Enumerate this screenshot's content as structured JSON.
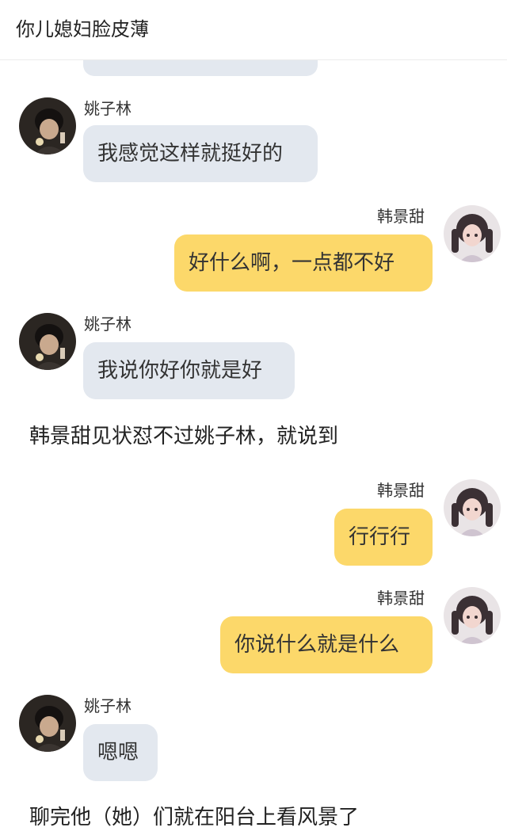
{
  "header": {
    "title": "你儿媳妇脸皮薄"
  },
  "participants": {
    "left_name": "姚子林",
    "right_name": "韩景甜"
  },
  "messages": [
    {
      "side": "left",
      "sender": "姚子林",
      "text": "我感觉这样就挺好的"
    },
    {
      "side": "right",
      "sender": "韩景甜",
      "text": "好什么啊，一点都不好"
    },
    {
      "side": "left",
      "sender": "姚子林",
      "text": "我说你好你就是好"
    },
    {
      "type": "narration",
      "text": "韩景甜见状怼不过姚子林，就说到"
    },
    {
      "side": "right",
      "sender": "韩景甜",
      "text": "行行行"
    },
    {
      "side": "right",
      "sender": "韩景甜",
      "text": "你说什么就是什么"
    },
    {
      "side": "left",
      "sender": "姚子林",
      "text": "嗯嗯"
    },
    {
      "type": "narration",
      "text": "聊完他（她）们就在阳台上看风景了"
    }
  ],
  "colors": {
    "left_bubble": "#e3e8ef",
    "right_bubble": "#fcd86a",
    "background": "#ffffff"
  },
  "icons": {
    "left_avatar": "dark-haired-person-avatar",
    "right_avatar": "girl-with-pigtails-avatar"
  }
}
